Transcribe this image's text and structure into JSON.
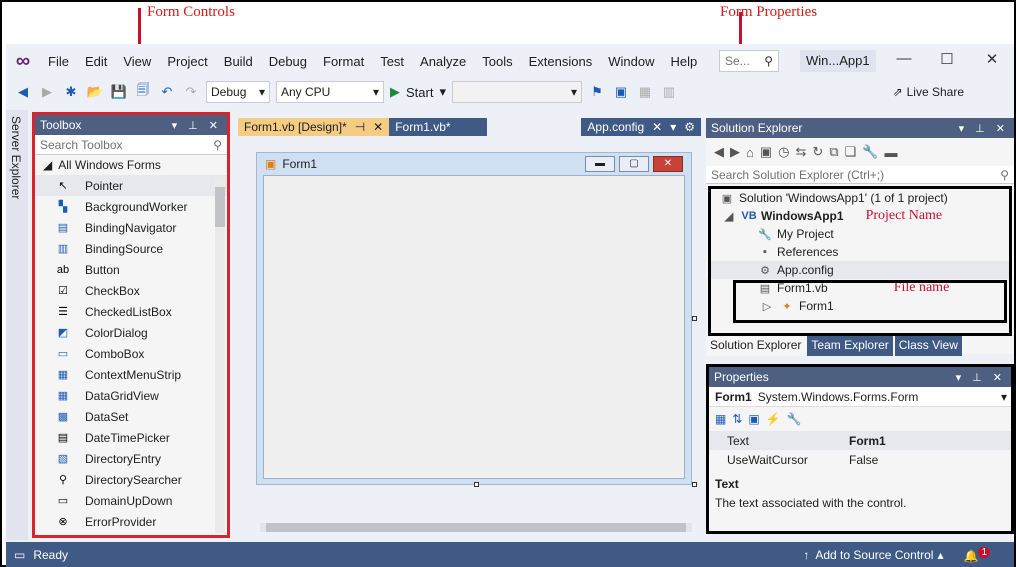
{
  "annotations": {
    "form_controls": "Form Controls",
    "form_properties": "Form Properties",
    "project_name": "Project Name",
    "file_name": "File name"
  },
  "menu": [
    "File",
    "Edit",
    "View",
    "Project",
    "Build",
    "Debug",
    "Format",
    "Test",
    "Analyze",
    "Tools",
    "Extensions",
    "Window",
    "Help"
  ],
  "search_placeholder": "Se...",
  "window_title": "Win...App1",
  "toolbar": {
    "config": "Debug",
    "platform": "Any CPU",
    "start": "Start",
    "live_share": "Live Share"
  },
  "server_explorer": "Server Explorer",
  "toolbox": {
    "title": "Toolbox",
    "search": "Search Toolbox",
    "category": "All Windows Forms",
    "items": [
      "Pointer",
      "BackgroundWorker",
      "BindingNavigator",
      "BindingSource",
      "Button",
      "CheckBox",
      "CheckedListBox",
      "ColorDialog",
      "ComboBox",
      "ContextMenuStrip",
      "DataGridView",
      "DataSet",
      "DateTimePicker",
      "DirectoryEntry",
      "DirectorySearcher",
      "DomainUpDown",
      "ErrorProvider"
    ]
  },
  "doc_tabs": {
    "active": "Form1.vb [Design]*",
    "second": "Form1.vb*",
    "third": "App.config"
  },
  "form": {
    "title": "Form1"
  },
  "solution_explorer": {
    "title": "Solution Explorer",
    "search": "Search Solution Explorer (Ctrl+;)",
    "solution": "Solution 'WindowsApp1' (1 of 1 project)",
    "project": "WindowsApp1",
    "my_project": "My Project",
    "references": "References",
    "app_config": "App.config",
    "form_file": "Form1.vb",
    "form_class": "Form1",
    "tabs": [
      "Solution Explorer",
      "Team Explorer",
      "Class View"
    ]
  },
  "properties": {
    "title": "Properties",
    "object": "Form1",
    "object_type": "System.Windows.Forms.Form",
    "rows": [
      {
        "name": "Text",
        "value": "Form1"
      },
      {
        "name": "UseWaitCursor",
        "value": "False"
      }
    ],
    "desc_title": "Text",
    "desc_body": "The text associated with the control."
  },
  "status": {
    "ready": "Ready",
    "source_control": "Add to Source Control",
    "notifications": "1"
  }
}
